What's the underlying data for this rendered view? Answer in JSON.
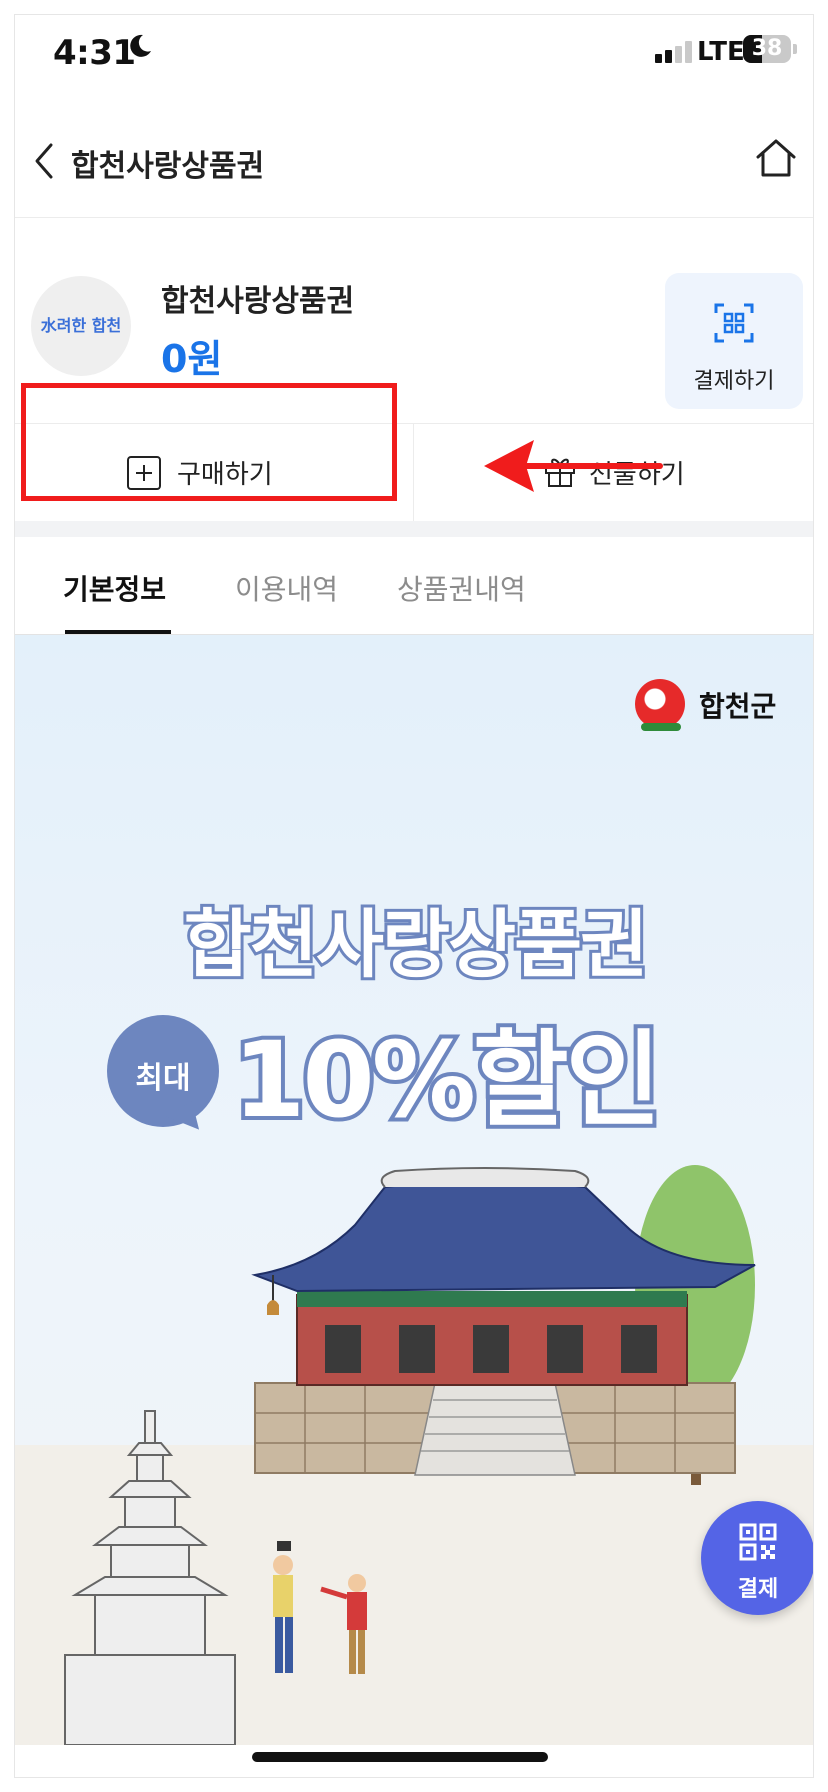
{
  "status_bar": {
    "time": "4:31",
    "network": "LTE",
    "battery": "38"
  },
  "nav": {
    "title": "합천사랑상품권"
  },
  "card": {
    "logo_text": "水려한 합천",
    "name": "합천사랑상품권",
    "amount": "0원",
    "pay_label": "결제하기",
    "buy_label": "구매하기",
    "gift_label": "선물하기"
  },
  "tabs": [
    {
      "label": "기본정보",
      "active": true
    },
    {
      "label": "이용내역",
      "active": false
    },
    {
      "label": "상품권내역",
      "active": false
    }
  ],
  "banner": {
    "county": "합천군",
    "headline": "합천사랑상품권",
    "bubble": "최대",
    "discount": "10%할인"
  },
  "fab": {
    "label": "결제"
  },
  "colors": {
    "accent": "#1a74e8",
    "fab": "#5464e6",
    "annotation": "#f01c1c",
    "headline_stroke": "#6d86bf"
  }
}
